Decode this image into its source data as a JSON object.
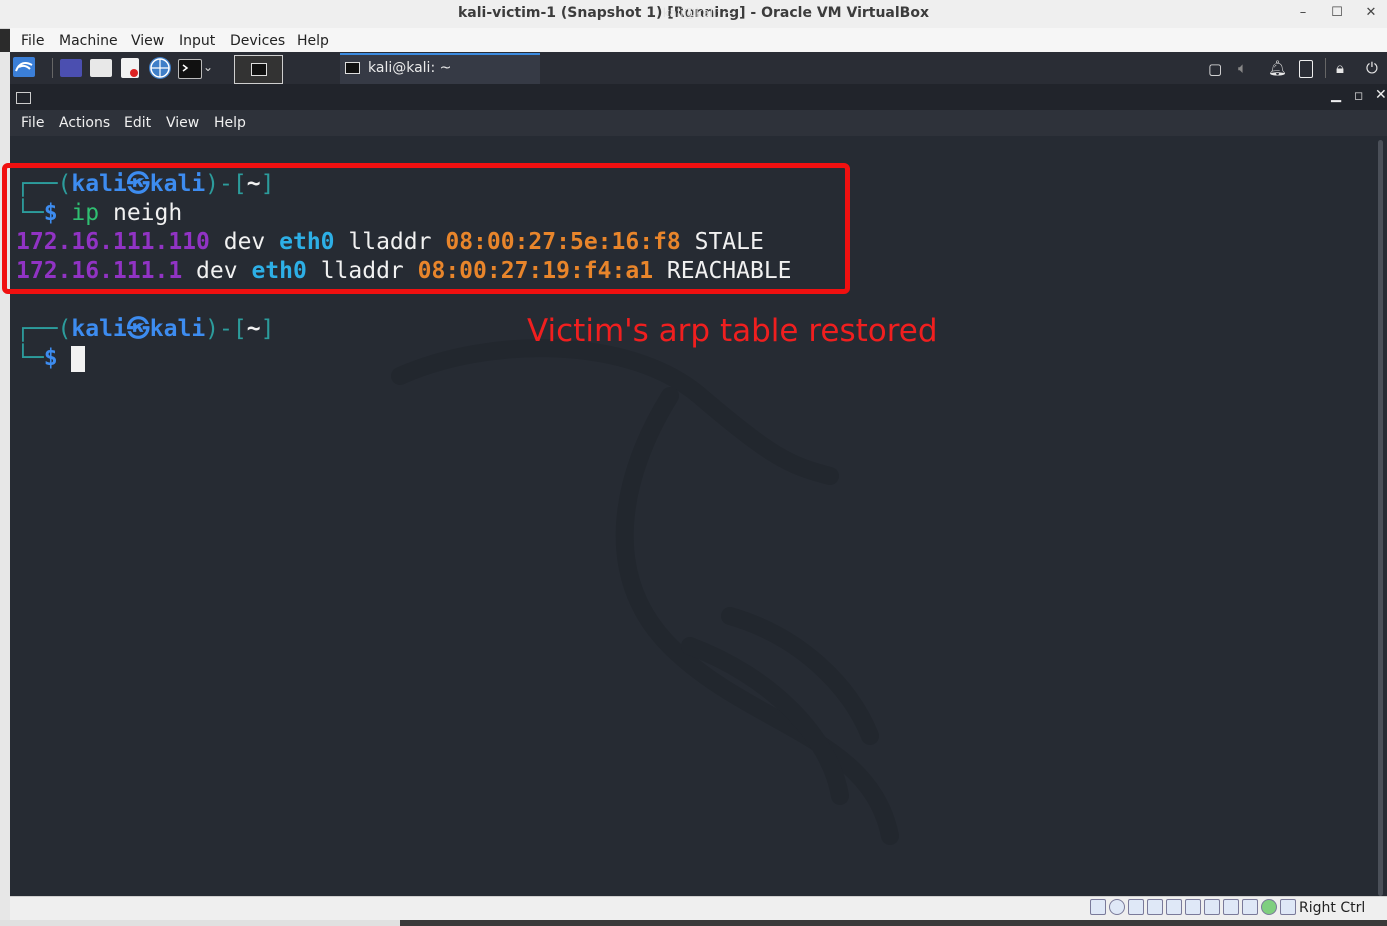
{
  "host": {
    "title": "kali-victim-1 (Snapshot 1) [Running] - Oracle VM VirtualBox",
    "controls": [
      "–",
      "☐",
      "✕"
    ],
    "menu": [
      "File",
      "Machine",
      "View",
      "Input",
      "Devices",
      "Help"
    ],
    "host_key": "Right Ctrl"
  },
  "guest_panel": {
    "task_label": "kali@kali: ~",
    "tray_icons": [
      "screen-icon",
      "volume-icon",
      "bell-icon",
      "battery-icon",
      "lock-icon",
      "power-icon"
    ]
  },
  "terminal": {
    "title": "kali@kali: ~",
    "menu": [
      "File",
      "Actions",
      "Edit",
      "View",
      "Help"
    ],
    "prompt": {
      "corner_top": "┌──(",
      "user": "kali",
      "sep": "㉿",
      "host": "kali",
      "mid": ")-[",
      "dir": "~",
      "end": "]",
      "corner_bottom": "└─",
      "dollar": "$"
    },
    "command": {
      "cmd": "ip",
      "args": "neigh"
    },
    "neighbors": [
      {
        "ip": "172.16.111.110",
        "dev_kw": "dev",
        "dev": "eth0",
        "ll_kw": "lladdr",
        "mac": "08:00:27:5e:16:f8",
        "state": "STALE"
      },
      {
        "ip": "172.16.111.1",
        "dev_kw": "dev",
        "dev": "eth0",
        "ll_kw": "lladdr",
        "mac": "08:00:27:19:f4:a1",
        "state": "REACHABLE"
      }
    ]
  },
  "annotation": {
    "text": "Victim's arp table restored",
    "color": "#f01f1f"
  }
}
